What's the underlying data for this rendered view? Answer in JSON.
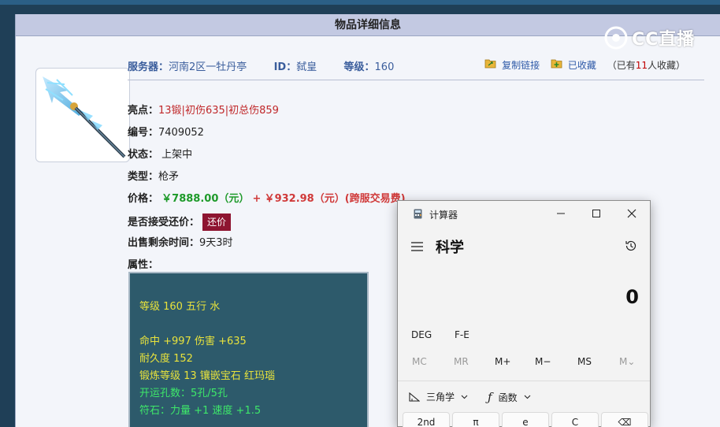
{
  "panel": {
    "title": "物品详细信息"
  },
  "logo": {
    "text": "CC直播"
  },
  "item_meta": {
    "server_label": "服务器：",
    "server_value": "河南2区一牡丹亭",
    "id_label": "ID：",
    "id_value": "弑皇",
    "level_label": "等级：",
    "level_value": "160"
  },
  "actions": {
    "copy_link": "复制链接",
    "favorited": "已收藏",
    "fav_prefix": "（已有",
    "fav_count": "11",
    "fav_suffix": "人收藏）"
  },
  "details": {
    "highlights_label": "亮点：",
    "highlights_value": "13锻|初伤635|初总伤859",
    "number_label": "编号：",
    "number_value": "7409052",
    "status_label": "状态：",
    "status_value": "上架中",
    "type_label": "类型：",
    "type_value": "枪矛",
    "price_label": "价格：",
    "price_value": "￥7888.00（元）",
    "price_plus": "+",
    "fee_value": "￥932.98（元）(跨服交易费)",
    "haggle_label": "是否接受还价：",
    "haggle_button": "还价",
    "time_left_label": "出售剩余时间：",
    "time_left_value": "9天3时",
    "attributes_label": "属性："
  },
  "attributes": {
    "line1": "等级 160 五行 水",
    "line2": "命中 +997 伤害 +635",
    "line3": "耐久度 152",
    "line4": "锻炼等级 13 镶嵌宝石 红玛瑙",
    "line5": "开运孔数：5孔/5孔",
    "line6": "符石：力量 +1 速度 +1.5"
  },
  "calculator": {
    "app_name": "计算器",
    "mode": "科学",
    "display": "0",
    "angle_unit": "DEG",
    "fe": "F-E",
    "mem": [
      "MC",
      "MR",
      "M+",
      "M−",
      "MS",
      "M⌄"
    ],
    "trig": "三角学",
    "func": "函数",
    "keys": [
      "2nd",
      "π",
      "e",
      "C",
      "⌫"
    ]
  },
  "colors": {
    "accent_blue": "#3a5d9c",
    "price_green": "#1e9a2a",
    "highlight_red": "#c0282a",
    "haggle_bg": "#8e1531",
    "attr_bg": "#2d5a6b",
    "attr_yellow": "#e8e23c",
    "attr_green": "#3ee86a"
  }
}
